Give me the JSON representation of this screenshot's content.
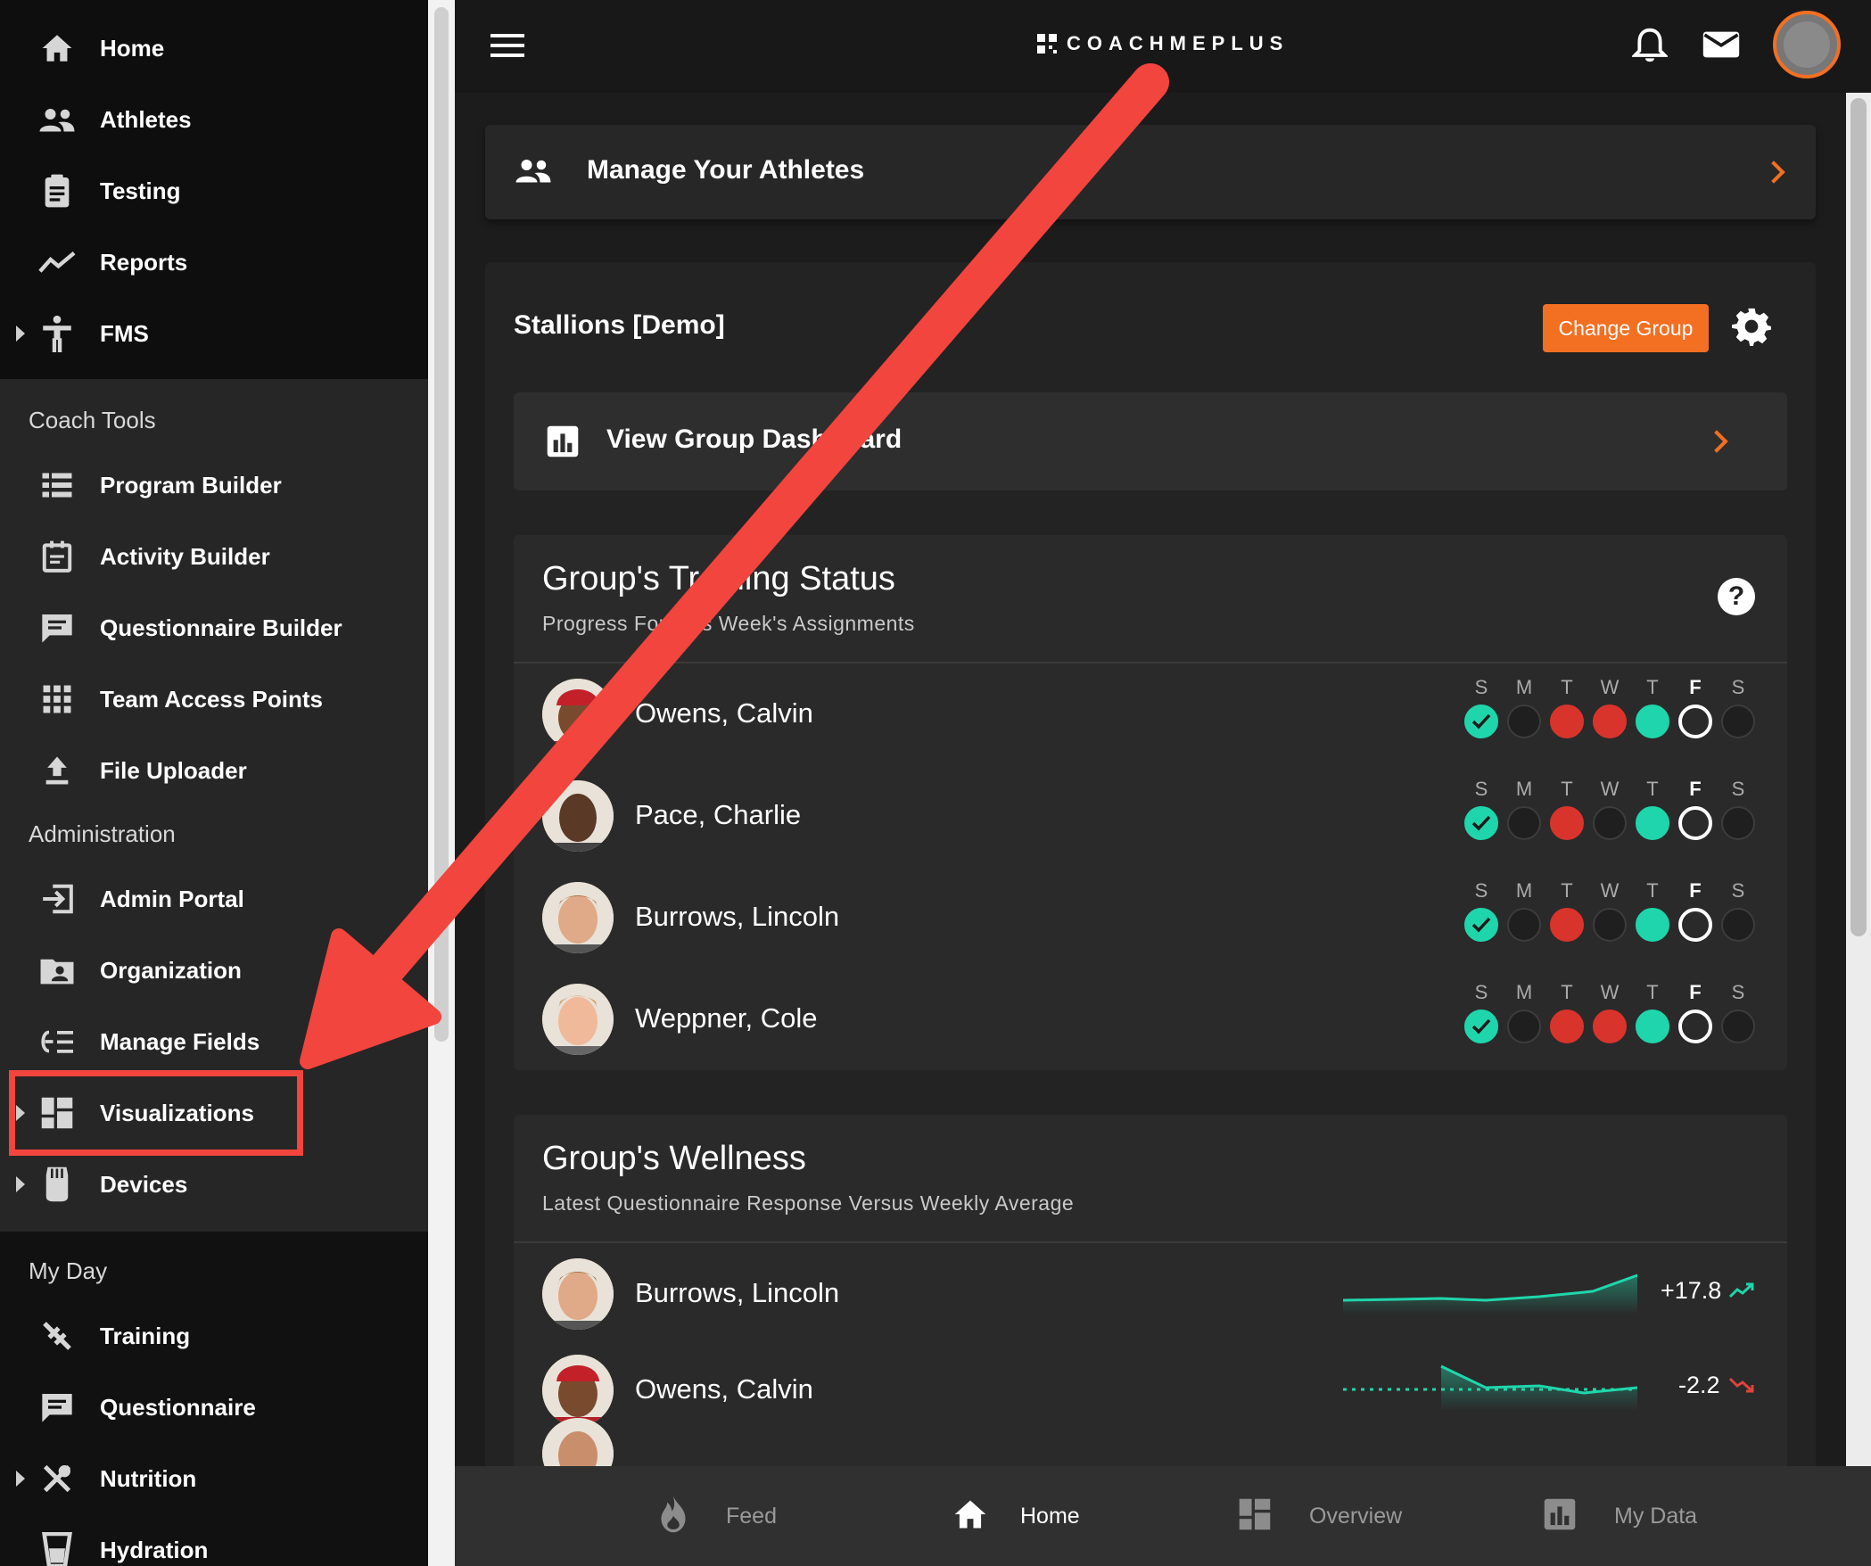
{
  "sidebar": {
    "top_items": [
      {
        "label": "Home",
        "icon": "home-icon"
      },
      {
        "label": "Athletes",
        "icon": "people-icon"
      },
      {
        "label": "Testing",
        "icon": "clipboard-icon"
      },
      {
        "label": "Reports",
        "icon": "trend-icon"
      },
      {
        "label": "FMS",
        "icon": "figure-icon"
      }
    ],
    "coach_tools_heading": "Coach Tools",
    "coach_tools": [
      {
        "label": "Program Builder",
        "icon": "list-icon"
      },
      {
        "label": "Activity Builder",
        "icon": "calendar-icon"
      },
      {
        "label": "Questionnaire Builder",
        "icon": "chat-icon"
      },
      {
        "label": "Team Access Points",
        "icon": "grid-icon"
      },
      {
        "label": "File Uploader",
        "icon": "upload-icon"
      }
    ],
    "administration_heading": "Administration",
    "administration": [
      {
        "label": "Admin Portal",
        "icon": "login-icon"
      },
      {
        "label": "Organization",
        "icon": "folder-user-icon"
      },
      {
        "label": "Manage Fields",
        "icon": "fields-icon"
      },
      {
        "label": "Visualizations",
        "icon": "dashboard-icon"
      },
      {
        "label": "Devices",
        "icon": "watch-icon"
      }
    ],
    "my_day_heading": "My Day",
    "my_day": [
      {
        "label": "Training",
        "icon": "dumbbell-icon"
      },
      {
        "label": "Questionnaire",
        "icon": "chat-icon"
      },
      {
        "label": "Nutrition",
        "icon": "utensils-icon"
      },
      {
        "label": "Hydration",
        "icon": "cup-icon"
      }
    ]
  },
  "header": {
    "logo_text": "COACHMEPLUS"
  },
  "manage_card": {
    "title": "Manage Your Athletes"
  },
  "group": {
    "name": "Stallions [Demo]",
    "change_button": "Change Group",
    "dashboard_link": "View Group Dashboard"
  },
  "training_status": {
    "title": "Group's Training Status",
    "subtitle": "Progress For This Week's Assignments",
    "help": "?",
    "days": [
      "S",
      "M",
      "T",
      "W",
      "T",
      "F",
      "S"
    ],
    "athletes": [
      {
        "name": "Owens, Calvin",
        "states": [
          "check",
          "empty",
          "red",
          "red",
          "teal",
          "today",
          "empty"
        ]
      },
      {
        "name": "Pace, Charlie",
        "states": [
          "check",
          "empty",
          "red",
          "empty",
          "teal",
          "today",
          "empty"
        ]
      },
      {
        "name": "Burrows, Lincoln",
        "states": [
          "check",
          "empty",
          "red",
          "empty",
          "teal",
          "today",
          "empty"
        ]
      },
      {
        "name": "Weppner, Cole",
        "states": [
          "check",
          "empty",
          "red",
          "red",
          "teal",
          "today",
          "empty"
        ]
      }
    ]
  },
  "wellness": {
    "title": "Group's Wellness",
    "subtitle": "Latest Questionnaire Response Versus Weekly Average",
    "athletes": [
      {
        "name": "Burrows, Lincoln",
        "value": "+17.8",
        "trend": "up"
      },
      {
        "name": "Owens, Calvin",
        "value": "-2.2",
        "trend": "down"
      }
    ]
  },
  "bottom_nav": [
    {
      "label": "Feed",
      "icon": "flame-icon"
    },
    {
      "label": "Home",
      "icon": "home-icon"
    },
    {
      "label": "Overview",
      "icon": "dashboard-icon"
    },
    {
      "label": "My Data",
      "icon": "bar-chart-icon"
    }
  ],
  "colors": {
    "accent": "#f36f21",
    "teal": "#1fd6ac",
    "red": "#d8342c",
    "annotation": "#f2453d"
  }
}
